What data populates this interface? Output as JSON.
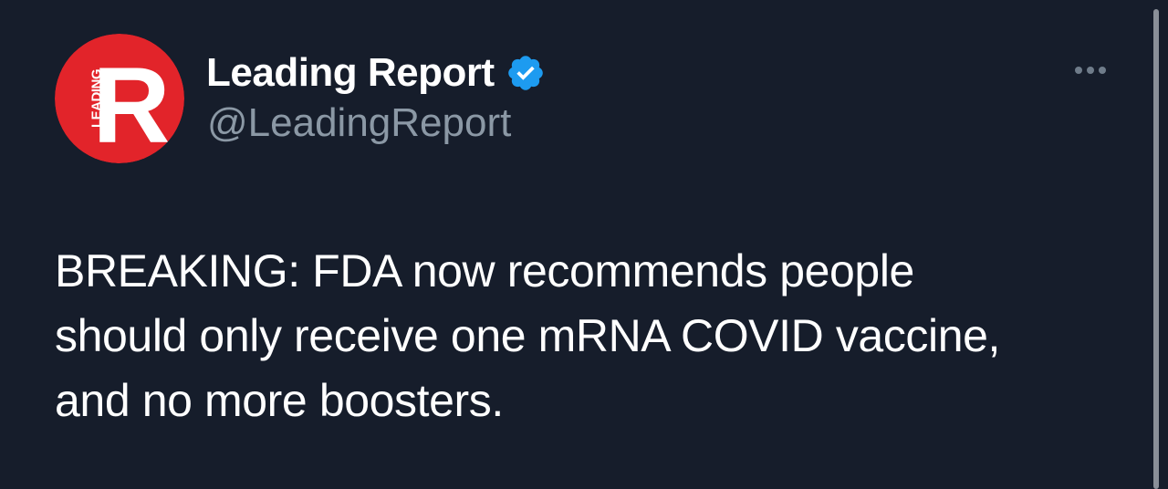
{
  "author": {
    "display_name": "Leading Report",
    "handle": "@LeadingReport",
    "verified": true,
    "avatar": {
      "letter": "R",
      "side_text": "LEADING",
      "background_color": "#e2242a",
      "foreground_color": "#ffffff"
    }
  },
  "tweet": {
    "lines": [
      "BREAKING: FDA now recommends people",
      "should only receive one mRNA COVID vaccine,",
      "and no more boosters."
    ]
  },
  "icons": {
    "verified": "verified-badge-icon",
    "more": "more-options-icon"
  },
  "colors": {
    "background": "#161d2b",
    "text_primary": "#ffffff",
    "text_secondary": "#8b98a5",
    "verified_blue": "#1d9bf0",
    "scrollbar": "#8a8f98"
  }
}
